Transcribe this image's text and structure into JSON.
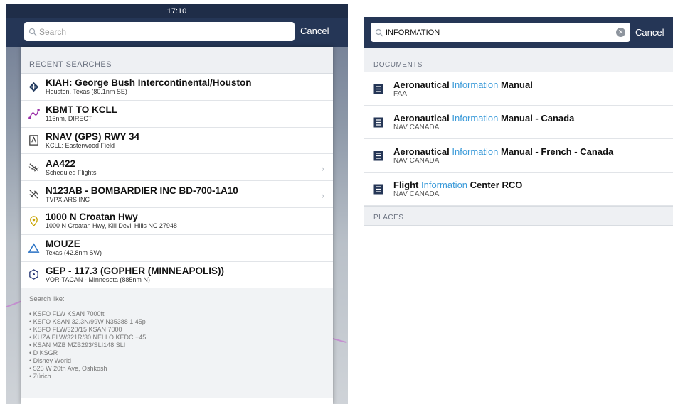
{
  "left": {
    "status_time": "17:10",
    "search": {
      "placeholder": "Search",
      "value": ""
    },
    "cancel_label": "Cancel",
    "recent_header": "RECENT SEARCHES",
    "items": [
      {
        "icon": "airport-icon",
        "title": "KIAH: George Bush Intercontinental/Houston",
        "sub": "Houston, Texas  (80.1nm SE)",
        "chevron": false
      },
      {
        "icon": "route-icon",
        "title": "KBMT TO KCLL",
        "sub": "116nm, DIRECT",
        "chevron": false
      },
      {
        "icon": "approach-plate-icon",
        "title": "RNAV (GPS) RWY 34",
        "sub": "KCLL: Easterwood Field",
        "chevron": false
      },
      {
        "icon": "scheduled-flight-icon",
        "title": "AA422",
        "sub": "Scheduled Flights",
        "chevron": true
      },
      {
        "icon": "aircraft-icon",
        "title": "N123AB - BOMBARDIER INC BD-700-1A10",
        "sub": "TVPX ARS INC",
        "chevron": true
      },
      {
        "icon": "address-pin-icon",
        "title": "1000 N Croatan Hwy",
        "sub": "1000 N Croatan Hwy, Kill Devil Hills NC 27948",
        "chevron": false
      },
      {
        "icon": "waypoint-icon",
        "title": "MOUZE",
        "sub": "Texas  (42.8nm SW)",
        "chevron": false
      },
      {
        "icon": "vor-icon",
        "title": "GEP - 117.3 (GOPHER (MINNEAPOLIS))",
        "sub": "VOR-TACAN - Minnesota  (885nm N)",
        "chevron": false
      }
    ],
    "hints_label": "Search like:",
    "hints": [
      "KSFO FLW KSAN 7000ft",
      "KSFO KSAN 32.3N/99W N35388 1:45p",
      "KSFO FLW/320/15 KSAN 7000",
      "KUZA ELW/321R/30 NELLO KEDC +45",
      "KSAN MZB MZB293/SLI148 SLI",
      "D KSGR",
      "Disney World",
      "525 W 20th Ave, Oshkosh",
      "Zürich"
    ]
  },
  "right": {
    "search": {
      "value": "INFORMATION"
    },
    "cancel_label": "Cancel",
    "documents_header": "DOCUMENTS",
    "docs": [
      {
        "pre": "Aeronautical ",
        "hl": "Information",
        "post": " Manual",
        "sub": "FAA"
      },
      {
        "pre": "Aeronautical ",
        "hl": "Information",
        "post": " Manual - Canada",
        "sub": "NAV CANADA"
      },
      {
        "pre": "Aeronautical ",
        "hl": "Information",
        "post": " Manual - French - Canada",
        "sub": "NAV CANADA"
      },
      {
        "pre": "Flight ",
        "hl": "Information",
        "post": " Center RCO",
        "sub": "NAV CANADA"
      }
    ],
    "places_header": "PLACES"
  }
}
